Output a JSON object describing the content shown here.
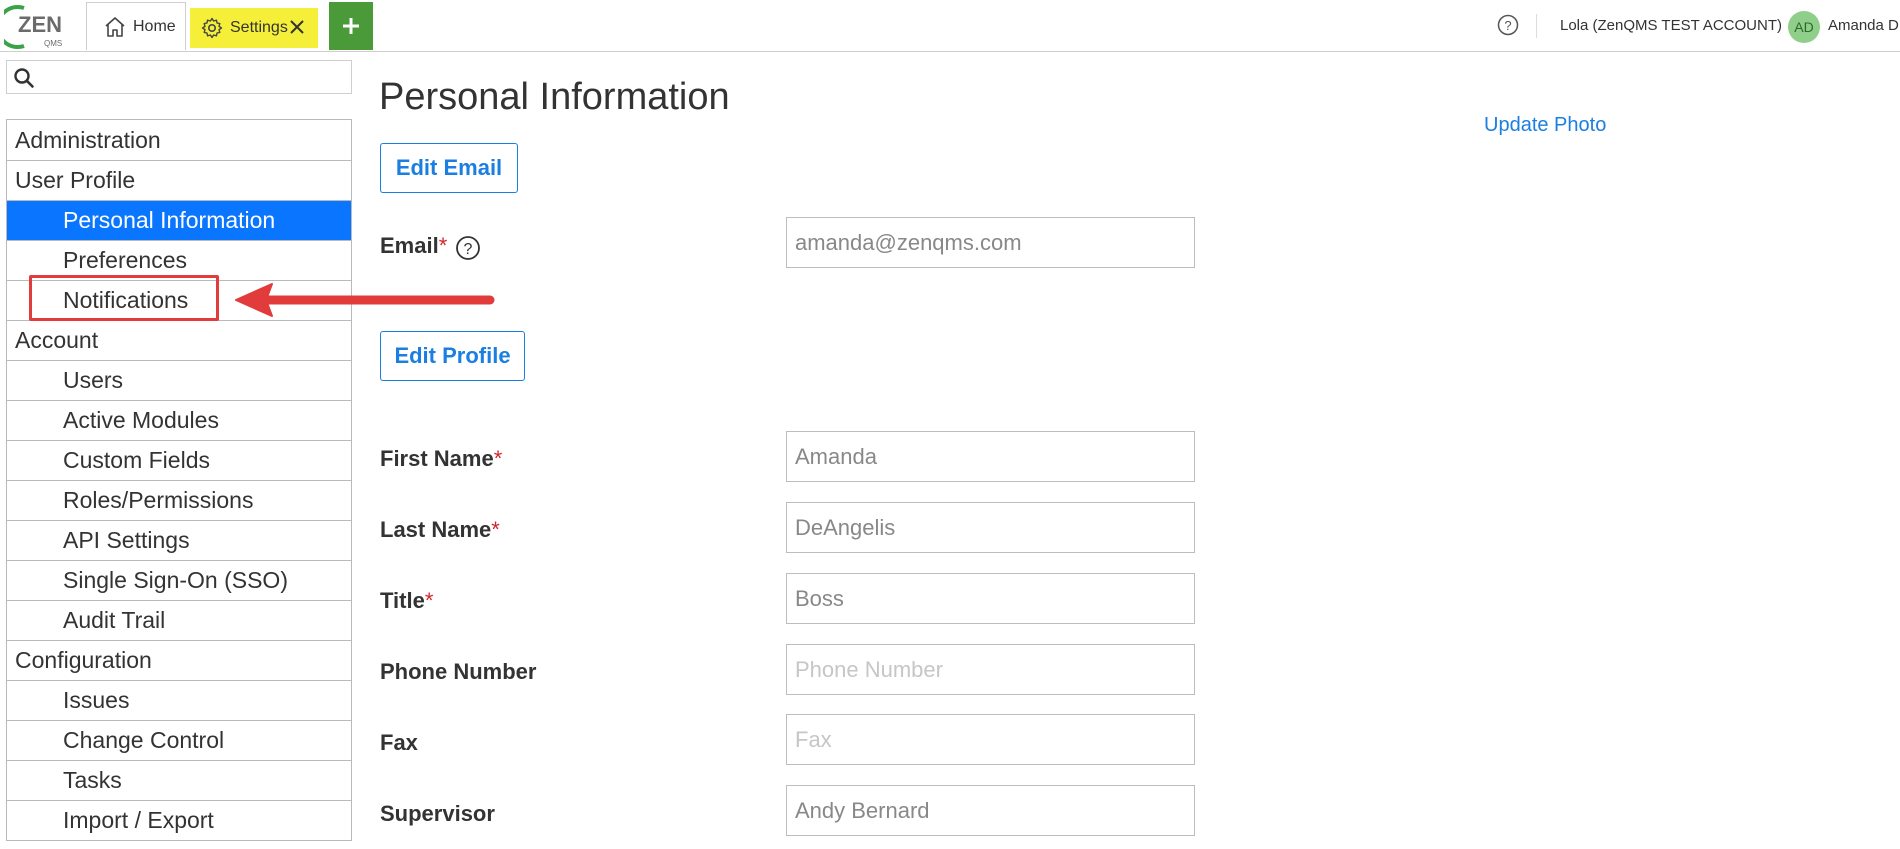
{
  "topbar": {
    "logo_text": "ZEN",
    "logo_subtext": "QMS",
    "tabs": [
      {
        "label": "Home",
        "icon": "home-icon"
      },
      {
        "label": "Settings",
        "icon": "gear-icon",
        "active": true,
        "highlight_color": "#f5ef3a"
      }
    ],
    "add_tab_icon": "plus-icon",
    "help_icon": "question-circle-icon",
    "account_label": "Lola (ZenQMS TEST ACCOUNT)",
    "avatar_initials": "AD",
    "user_name": "Amanda D"
  },
  "sidebar": {
    "search": {
      "placeholder": "",
      "value": ""
    },
    "items": [
      {
        "label": "Administration",
        "level": "section"
      },
      {
        "label": "User Profile",
        "level": "section"
      },
      {
        "label": "Personal Information",
        "level": "sub",
        "active": true
      },
      {
        "label": "Preferences",
        "level": "sub"
      },
      {
        "label": "Notifications",
        "level": "sub",
        "annotated": true
      },
      {
        "label": "Account",
        "level": "section"
      },
      {
        "label": "Users",
        "level": "sub"
      },
      {
        "label": "Active Modules",
        "level": "sub"
      },
      {
        "label": "Custom Fields",
        "level": "sub"
      },
      {
        "label": "Roles/Permissions",
        "level": "sub"
      },
      {
        "label": "API Settings",
        "level": "sub"
      },
      {
        "label": "Single Sign-On (SSO)",
        "level": "sub"
      },
      {
        "label": "Audit Trail",
        "level": "sub"
      },
      {
        "label": "Configuration",
        "level": "section"
      },
      {
        "label": "Issues",
        "level": "sub"
      },
      {
        "label": "Change Control",
        "level": "sub"
      },
      {
        "label": "Tasks",
        "level": "sub"
      },
      {
        "label": "Import / Export",
        "level": "sub"
      }
    ]
  },
  "main": {
    "title": "Personal Information",
    "update_photo_label": "Update Photo",
    "edit_email_label": "Edit Email",
    "edit_profile_label": "Edit Profile",
    "required_mark": "*",
    "fields": {
      "email": {
        "label": "Email",
        "value": "amanda@zenqms.com",
        "required": true
      },
      "first_name": {
        "label": "First Name",
        "value": "Amanda",
        "required": true
      },
      "last_name": {
        "label": "Last Name",
        "value": "DeAngelis",
        "required": true
      },
      "title": {
        "label": "Title",
        "value": "Boss",
        "required": true
      },
      "phone": {
        "label": "Phone Number",
        "value": "",
        "placeholder": "Phone Number",
        "required": false
      },
      "fax": {
        "label": "Fax",
        "value": "",
        "placeholder": "Fax",
        "required": false
      },
      "supervisor": {
        "label": "Supervisor",
        "value": "Andy Bernard",
        "required": false
      }
    }
  },
  "colors": {
    "accent": "#1a7fe0",
    "active_nav": "#0a75ff",
    "tab_highlight": "#f5ef3a",
    "add_tab": "#4a9a3a",
    "annotation": "#e23b3b",
    "required": "#d2252b"
  }
}
